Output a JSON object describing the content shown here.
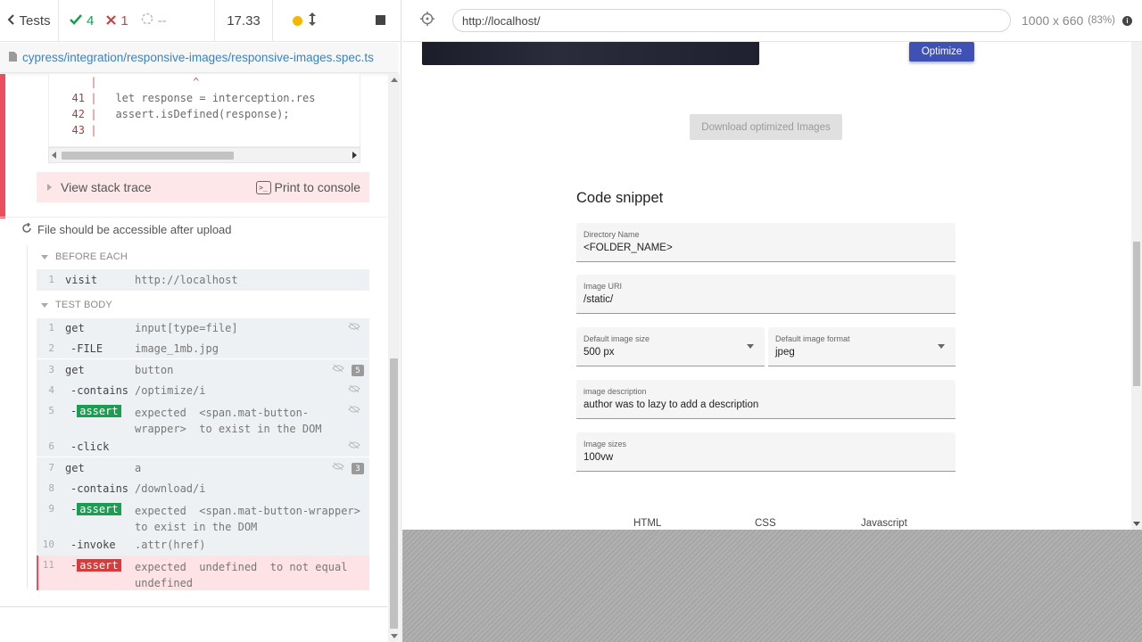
{
  "header": {
    "tests_label": "Tests",
    "passed": "4",
    "failed": "1",
    "pending": "--",
    "duration": "17.33"
  },
  "spec": {
    "path": "cypress/integration/responsive-images/responsive-images.spec.ts"
  },
  "code_frame": {
    "caret_line": {
      "pipe": "|",
      "code": "              ^"
    },
    "lines": [
      {
        "num": "41",
        "pipe": "|",
        "code": "  let response = interception.res"
      },
      {
        "num": "42",
        "pipe": "|",
        "code": "  assert.isDefined(response);"
      },
      {
        "num": "43",
        "pipe": "|",
        "code": ""
      }
    ]
  },
  "error_actions": {
    "view_stack": "View stack trace",
    "print": "Print to console"
  },
  "test": {
    "title": "File should be accessible after upload",
    "before_each_label": "BEFORE EACH",
    "test_body_label": "TEST BODY",
    "before_each": [
      {
        "num": "1",
        "name": "visit",
        "msg": "http://localhost"
      }
    ],
    "body": [
      {
        "num": "1",
        "name": "get",
        "msg": "input[type=file]"
      },
      {
        "num": "2",
        "name": "-FILE",
        "msg": "image_1mb.jpg"
      },
      {
        "num": "3",
        "name": "get",
        "msg": "button",
        "count": "5"
      },
      {
        "num": "4",
        "name": "-contains",
        "msg": "/optimize/i"
      },
      {
        "num": "5",
        "name": "assert",
        "msg_prefix": "expected",
        "msg_el": "<span.mat-button-",
        "msg_el2": "wrapper>",
        "msg_suffix": "to exist in the DOM"
      },
      {
        "num": "6",
        "name": "-click",
        "msg": ""
      },
      {
        "num": "7",
        "name": "get",
        "msg": "a",
        "count": "3"
      },
      {
        "num": "8",
        "name": "-contains",
        "msg": "/download/i"
      },
      {
        "num": "9",
        "name": "assert",
        "msg_prefix": "expected",
        "msg_el": "<span.mat-button-wrapper>",
        "msg_suffix": "to exist in the DOM"
      },
      {
        "num": "10",
        "name": "-invoke",
        "msg": ".attr(href)"
      },
      {
        "num": "11",
        "name": "assert",
        "msg_prefix": "expected",
        "msg_el": "undefined",
        "msg_mid": "to not equal",
        "msg_el2": "undefined"
      }
    ]
  },
  "aut": {
    "url": "http://localhost/",
    "viewport": "1000 x 660",
    "scale": "(83%)",
    "info_icon_label": "i",
    "optimize_label": "Optimize",
    "download_label": "Download optimized Images",
    "snippet_title": "Code snippet",
    "fields": {
      "directory": {
        "label": "Directory Name",
        "value": "<FOLDER_NAME>"
      },
      "image_uri": {
        "label": "Image URI",
        "value": "/static/"
      },
      "size": {
        "label": "Default image size",
        "value": "500 px"
      },
      "format": {
        "label": "Default image format",
        "value": "jpeg"
      },
      "description": {
        "label": "image description",
        "value": "author was to lazy to add a description"
      },
      "sizes": {
        "label": "Image sizes",
        "value": "100vw"
      }
    },
    "tabs": [
      "HTML",
      "CSS",
      "Javascript"
    ]
  },
  "colors": {
    "pass": "#1a9e51",
    "fail": "#d63c3c",
    "accent": "#3f51b5",
    "link": "#3b82c4"
  }
}
